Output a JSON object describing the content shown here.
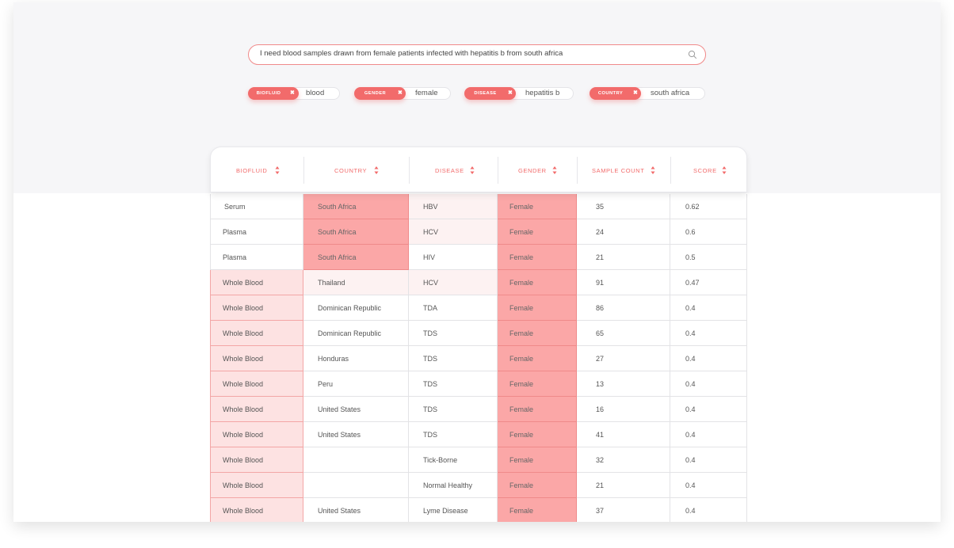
{
  "search": {
    "query": "I need blood samples drawn from female patients infected with hepatitis b from south africa",
    "icon": "search-icon"
  },
  "filters": [
    {
      "label": "BIOFLUID",
      "value": "blood"
    },
    {
      "label": "GENDER",
      "value": "female"
    },
    {
      "label": "DISEASE",
      "value": "hepatitis b"
    },
    {
      "label": "COUNTRY",
      "value": "south africa"
    }
  ],
  "colors": {
    "accent": "#f26b6b",
    "highlight_strong": "#fba7a7",
    "highlight_light": "#fde2e2",
    "highlight_faint": "#fdf2f2"
  },
  "table": {
    "columns": [
      "BIOFLUID",
      "COUNTRY",
      "DISEASE",
      "GENDER",
      "SAMPLE COUNT",
      "SCORE"
    ],
    "rows": [
      [
        "Serum",
        "South Africa",
        "HBV",
        "Female",
        "35",
        "0.62"
      ],
      [
        "Plasma",
        "South Africa",
        "HCV",
        "Female",
        "24",
        "0.6"
      ],
      [
        "Plasma",
        "South Africa",
        "HIV",
        "Female",
        "21",
        "0.5"
      ],
      [
        "Whole Blood",
        "Thailand",
        "HCV",
        "Female",
        "91",
        "0.47"
      ],
      [
        "Whole Blood",
        "Dominican Republic",
        "TDA",
        "Female",
        "86",
        "0.4"
      ],
      [
        "Whole Blood",
        "Dominican Republic",
        "TDS",
        "Female",
        "65",
        "0.4"
      ],
      [
        "Whole Blood",
        "Honduras",
        "TDS",
        "Female",
        "27",
        "0.4"
      ],
      [
        "Whole Blood",
        "Peru",
        "TDS",
        "Female",
        "13",
        "0.4"
      ],
      [
        "Whole Blood",
        "United States",
        "TDS",
        "Female",
        "16",
        "0.4"
      ],
      [
        "Whole Blood",
        "United States",
        "TDS",
        "Female",
        "41",
        "0.4"
      ],
      [
        "Whole Blood",
        "",
        "Tick-Borne",
        "Female",
        "32",
        "0.4"
      ],
      [
        "Whole Blood",
        "",
        "Normal Healthy",
        "Female",
        "21",
        "0.4"
      ],
      [
        "Whole Blood",
        "United States",
        "Lyme Disease",
        "Female",
        "37",
        "0.4"
      ]
    ]
  }
}
